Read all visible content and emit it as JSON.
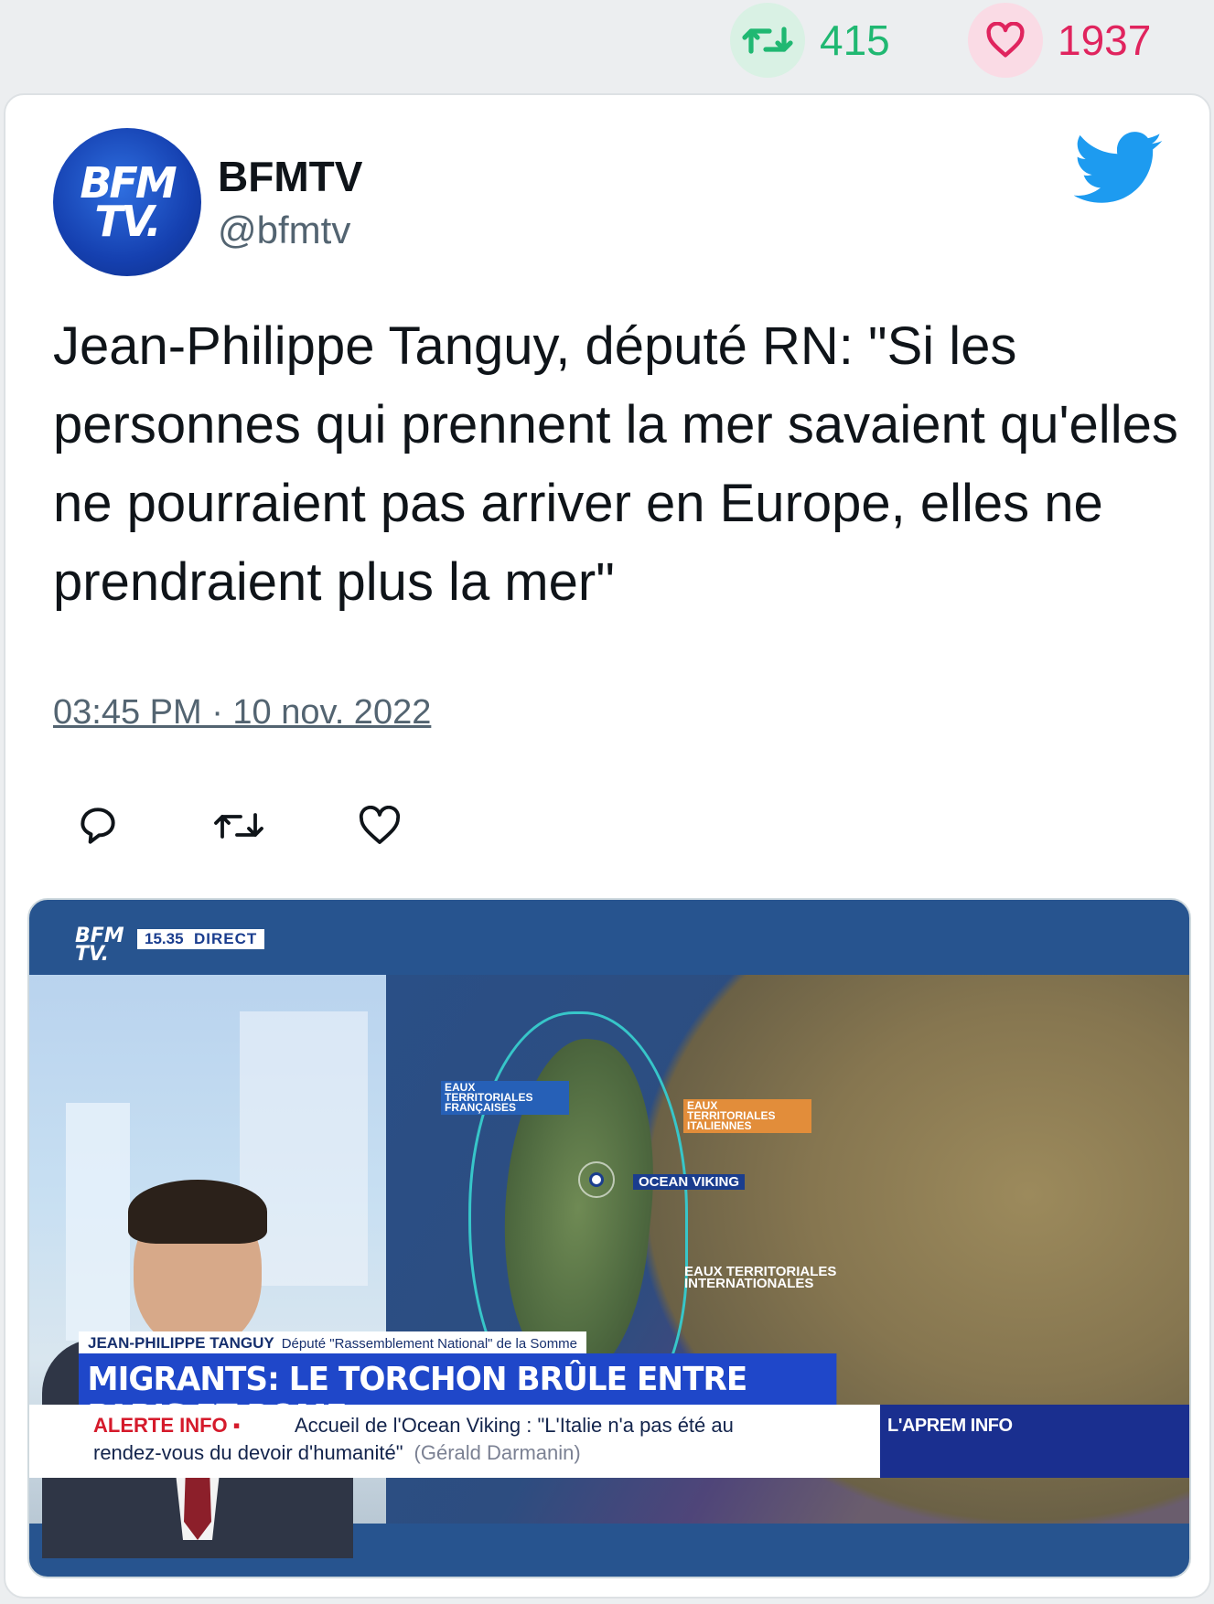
{
  "stats": {
    "retweets": "415",
    "likes": "1937",
    "retweet_icon": "retweet-icon",
    "like_icon": "heart-icon",
    "retweet_color": "#20b872",
    "like_color": "#e0245e"
  },
  "tweet": {
    "author_name": "BFMTV",
    "author_handle": "@bfmtv",
    "avatar_text_line1": "BFM",
    "avatar_text_line2": "TV.",
    "text": "Jean-Philippe Tanguy, député RN: \"Si les personnes qui prennent la mer savaient qu'elles ne pourraient pas arriver en Europe, elles ne prendraient plus la mer\"",
    "timestamp": "03:45 PM · 10 nov. 2022",
    "brand_color": "#1d9bf0",
    "actions": [
      "reply-icon",
      "retweet-icon",
      "like-icon"
    ]
  },
  "media": {
    "channel_logo_line1": "BFM",
    "channel_logo_line2": "TV.",
    "time": "15.35",
    "live_label": "DIRECT",
    "map_labels": {
      "french_waters": "EAUX TERRITORIALES FRANÇAISES",
      "italian_waters": "EAUX TERRITORIALES ITALIENNES",
      "international_waters": "EAUX TERRITORIALES INTERNATIONALES",
      "ship": "OCEAN VIKING"
    },
    "guest_name": "JEAN-PHILIPPE TANGUY",
    "guest_title": "Député \"Rassemblement National\" de la Somme",
    "headline": "MIGRANTS: LE TORCHON BRÛLE ENTRE PARIS ET ROME",
    "alert_label": "ALERTE INFO ▪",
    "ticker_line1": "Accueil de l'Ocean Viking : \"L'Italie n'a pas été au",
    "ticker_line2": "rendez-vous du devoir d'humanité\"",
    "ticker_source": "(Gérald Darmanin)",
    "program": "L'APREM INFO"
  }
}
